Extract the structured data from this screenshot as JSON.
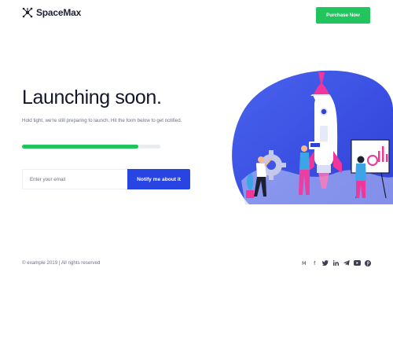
{
  "brand": {
    "name": "SpaceMax",
    "logo_icon": "molecule-icon"
  },
  "header": {
    "purchase_label": "Purchase Now"
  },
  "hero": {
    "title": "Launching soon.",
    "description": "Hold tight, we're still preparing to launch. Hit the form below to get notified.",
    "progress_percent": 84
  },
  "form": {
    "email_placeholder": "Enter your email",
    "submit_label": "Notify me about it"
  },
  "footer": {
    "copyright": "© example 2019 | All rights reserved",
    "social_icons": [
      "medium-icon",
      "facebook-icon",
      "twitter-icon",
      "linkedin-icon",
      "telegram-icon",
      "youtube-icon",
      "pinterest-icon"
    ],
    "medium_glyph": "M",
    "facebook_glyph": "f"
  },
  "colors": {
    "accent_green": "#22c45e",
    "accent_blue": "#2845e3",
    "hero_blob": "#3f55e8",
    "rocket_pink": "#f0359b"
  }
}
